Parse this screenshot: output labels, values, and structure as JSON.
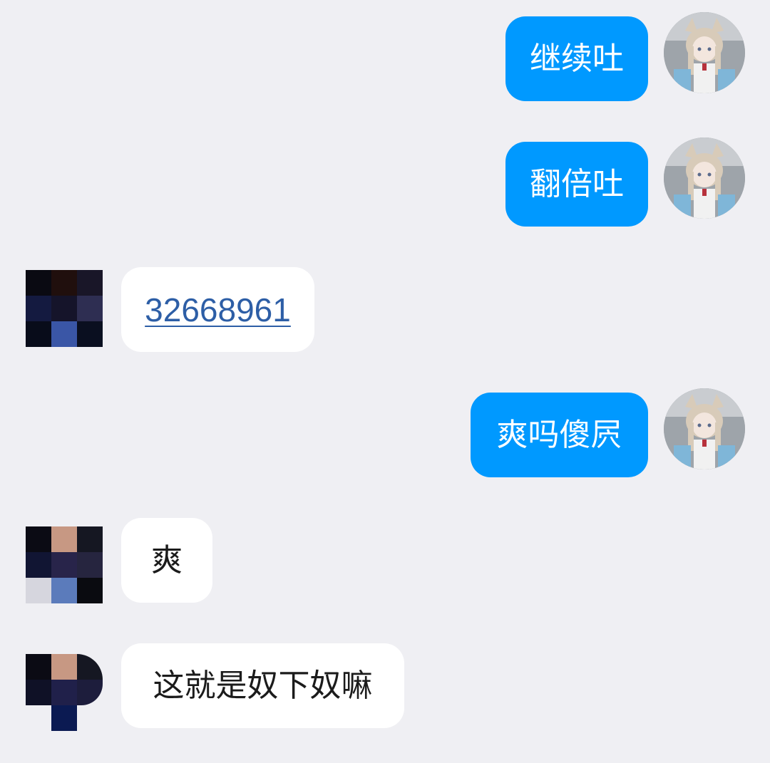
{
  "messages": [
    {
      "side": "right",
      "text": "继续吐"
    },
    {
      "side": "right",
      "text": "翻倍吐"
    },
    {
      "side": "left",
      "text": "32668961",
      "is_link": true
    },
    {
      "side": "right",
      "text": "爽吗傻屄"
    },
    {
      "side": "left",
      "text": "爽"
    },
    {
      "side": "left",
      "text": "这就是奴下奴嘛"
    }
  ],
  "colors": {
    "background": "#efeff3",
    "my_bubble": "#0099ff",
    "other_bubble": "#ffffff",
    "link_text": "#2d5ea6"
  },
  "icons": {
    "my_avatar": "anime-girl-avatar-icon",
    "other_avatar": "pixelated-avatar-icon"
  }
}
